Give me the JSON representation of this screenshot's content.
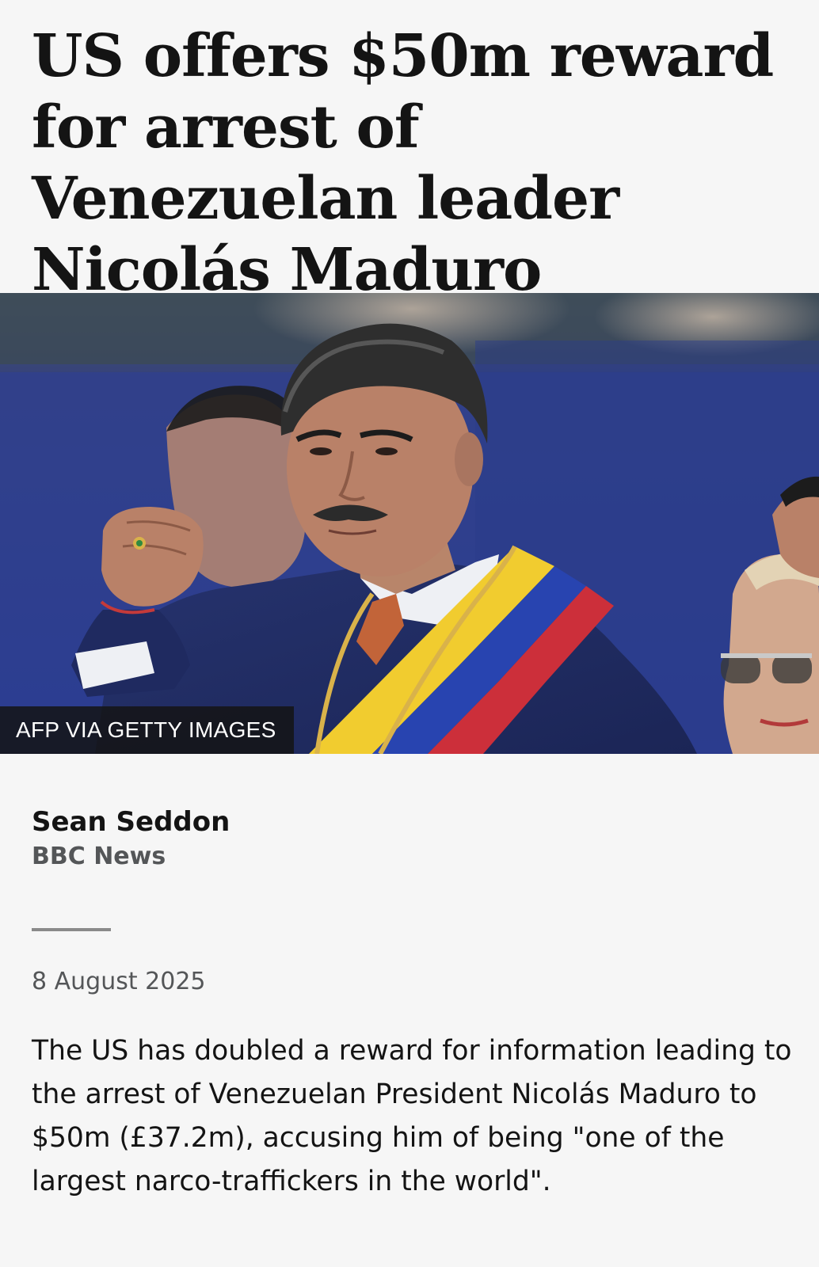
{
  "article": {
    "headline": "US offers $50m reward for arrest of Venezuelan leader Nicolás Maduro",
    "image_credit": "AFP VIA GETTY IMAGES",
    "author": "Sean Seddon",
    "outlet": "BBC News",
    "date": "8 August 2025",
    "lead": "The US has doubled a reward for information leading to the arrest of Venezuelan President Nicolás Maduro to $50m (£37.2m), accusing him of being \"one of the largest narco-traffickers in the world\"."
  }
}
